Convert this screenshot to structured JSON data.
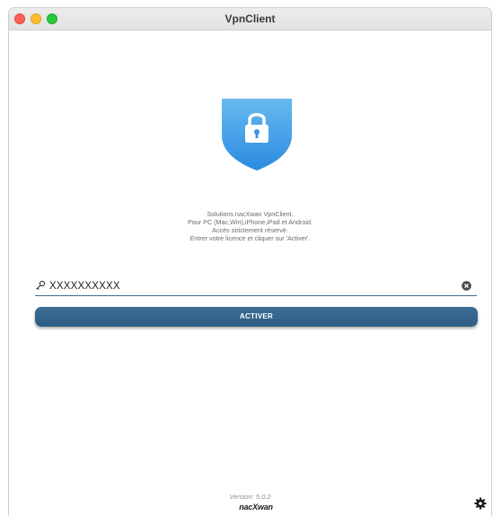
{
  "window": {
    "title": "VpnClient"
  },
  "intro": {
    "lines": [
      "Solutions nacXwan VpnClient.",
      "Pour PC (Mac,Win),iPhone,iPad et Android.",
      "Accès strictement réservé.",
      "Entrer votre licence et cliquer sur 'Activer'."
    ]
  },
  "license": {
    "value": "XXXXXXXXXX",
    "icon": "key-icon",
    "clear_icon": "clear-circle-icon"
  },
  "actions": {
    "activate_label": "ACTIVER"
  },
  "footer": {
    "version": "Version: 5.0.2",
    "brand": "nacXwan",
    "settings_icon": "gear-icon"
  },
  "colors": {
    "accent": "#2e5d84",
    "shield_light": "#5fb3ee",
    "shield_dark": "#2f8ee0"
  }
}
